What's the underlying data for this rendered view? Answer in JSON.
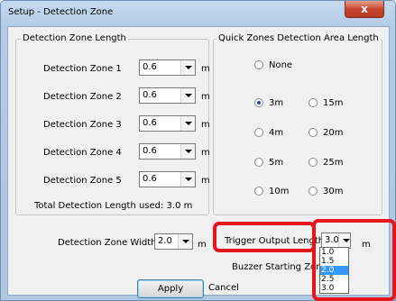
{
  "window": {
    "title": "Setup - Detection Zone",
    "close_glyph": "x"
  },
  "zones_group": {
    "legend": "Detection Zone Length",
    "rows": [
      {
        "label": "Detection Zone 1",
        "value": "0.6",
        "unit": "m"
      },
      {
        "label": "Detection Zone 2",
        "value": "0.6",
        "unit": "m"
      },
      {
        "label": "Detection Zone 3",
        "value": "0.6",
        "unit": "m"
      },
      {
        "label": "Detection Zone 4",
        "value": "0.6",
        "unit": "m"
      },
      {
        "label": "Detection Zone 5",
        "value": "0.6",
        "unit": "m"
      }
    ],
    "total": "Total Detection Length used: 3.0 m"
  },
  "quick_group": {
    "legend": "Quick Zones Detection Area Length",
    "options": [
      {
        "label": "None",
        "selected": false
      },
      {
        "label": "3m",
        "selected": true
      },
      {
        "label": "15m",
        "selected": false
      },
      {
        "label": "4m",
        "selected": false
      },
      {
        "label": "20m",
        "selected": false
      },
      {
        "label": "5m",
        "selected": false
      },
      {
        "label": "25m",
        "selected": false
      },
      {
        "label": "10m",
        "selected": false
      },
      {
        "label": "30m",
        "selected": false
      }
    ]
  },
  "zone_width": {
    "label": "Detection Zone Width:",
    "value": "2.0",
    "unit": "m"
  },
  "trigger": {
    "label": "Trigger Output Length:",
    "value": "3.0",
    "unit": "m",
    "options": [
      "1.0",
      "1.5",
      "2.0",
      "2.5",
      "3.0"
    ],
    "highlighted": "2.0"
  },
  "buzzer": {
    "label": "Buzzer Starting Zone:"
  },
  "buttons": {
    "apply": "Apply",
    "cancel": "Cancel"
  },
  "colors": {
    "annotation": "#e8141c",
    "selection": "#3399ff"
  }
}
